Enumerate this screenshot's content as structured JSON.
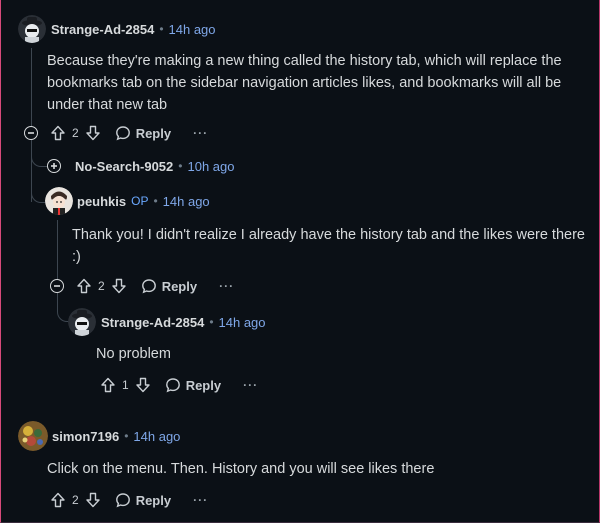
{
  "comments": [
    {
      "username": "Strange-Ad-2854",
      "time": "14h ago",
      "body": "Because they're making a new thing called the history tab, which will replace the bookmarks tab on the sidebar navigation articles likes, and bookmarks will all be under that new tab",
      "votes": "2",
      "reply_label": "Reply",
      "more_label": "···"
    },
    {
      "username": "No-Search-9052",
      "time": "10h ago"
    },
    {
      "username": "peuhkis",
      "op_badge": "OP",
      "time": "14h ago",
      "body": "Thank you! I didn't realize I already have the history tab and the likes were there :)",
      "votes": "2",
      "reply_label": "Reply",
      "more_label": "···"
    },
    {
      "username": "Strange-Ad-2854",
      "time": "14h ago",
      "body": "No problem",
      "votes": "1",
      "reply_label": "Reply",
      "more_label": "···"
    },
    {
      "username": "simon7196",
      "time": "14h ago",
      "body": "Click on the menu. Then. History and you will see likes there",
      "votes": "2",
      "reply_label": "Reply",
      "more_label": "···"
    }
  ],
  "separator": "•",
  "icons": {
    "upvote": "arrow-up-icon",
    "downvote": "arrow-down-icon",
    "reply": "speech-bubble-icon",
    "collapse": "minus-circle-icon",
    "expand": "plus-circle-icon"
  },
  "colors": {
    "background": "#0b1016",
    "time": "#7fa7e8",
    "op": "#6aa8ff",
    "text": "#d7dadc"
  }
}
